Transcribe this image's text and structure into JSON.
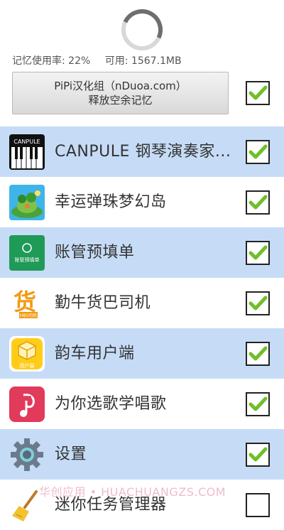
{
  "memory": {
    "usage": "记忆使用率: 22%",
    "available": "可用: 1567.1MB"
  },
  "release_button": {
    "line1": "PiPi汉化组（nDuoa.com）",
    "line2": "释放空余记忆",
    "checked": true
  },
  "apps": [
    {
      "name": "CANPULE 钢琴演奏家...",
      "icon": "piano-app-icon",
      "icon_text": "CANPULE",
      "checked": true,
      "highlighted": true
    },
    {
      "name": "幸运弹珠梦幻岛",
      "icon": "island-game-icon",
      "checked": true,
      "highlighted": false
    },
    {
      "name": "账管预填单",
      "icon": "form-app-icon",
      "icon_text": "账管预填单",
      "checked": true,
      "highlighted": true
    },
    {
      "name": "勤牛货巴司机",
      "icon": "cargo-app-icon",
      "icon_text": "货",
      "icon_subtext": "HBS司机",
      "checked": true,
      "highlighted": false
    },
    {
      "name": "韵车用户端",
      "icon": "cube-app-icon",
      "icon_text": "用户端",
      "checked": true,
      "highlighted": true
    },
    {
      "name": "为你选歌学唱歌",
      "icon": "music-app-icon",
      "checked": true,
      "highlighted": false
    },
    {
      "name": "设置",
      "icon": "settings-gear-icon",
      "checked": true,
      "highlighted": true
    },
    {
      "name": "迷你任务管理器",
      "icon": "broom-icon",
      "checked": false,
      "highlighted": false
    }
  ],
  "watermark": "华创应用 • HUACHUANGZS.COM",
  "colors": {
    "highlight": "#c6dcf6",
    "check": "#6fbf2a"
  }
}
